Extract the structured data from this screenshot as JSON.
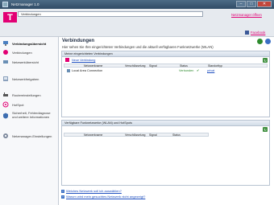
{
  "window": {
    "title": "Netzmanager 1.0",
    "minimize": "–",
    "maximize": "□",
    "close": "✕"
  },
  "header": {
    "address_value": "Verbindungen",
    "brand_mark": "T",
    "open_manager_link": "Netzmanager öffnen",
    "facebook_link": "Facebook"
  },
  "sidebar": {
    "items": [
      {
        "label": "Verbindungsübersicht",
        "icon": "network-overview-icon",
        "active": true
      },
      {
        "label": "Verbindungen",
        "icon": "connections-icon",
        "active": false
      },
      {
        "label": "Netzwerkübersicht",
        "icon": "network-map-icon",
        "active": false
      },
      {
        "label": "Netzwerkfreigaben",
        "icon": "share-icon",
        "active": false
      },
      {
        "label": "Routereinstellungen",
        "icon": "router-icon",
        "active": false
      },
      {
        "label": "HotSpot",
        "icon": "hotspot-icon",
        "active": false
      },
      {
        "label": "Sicherheit, Fehlerdiagnose und weitere Informationen",
        "icon": "security-icon",
        "active": false
      },
      {
        "label": "Netzmanager-Einstellungen",
        "icon": "settings-icon",
        "active": false
      }
    ]
  },
  "main": {
    "title": "Verbindungen",
    "subtitle": "Hier sehen Sie Ihre eingerichteten Verbindungen und die aktuell verfügbaren Funknetzwerke (WLAN)",
    "configured": {
      "header": "Meine eingerichteten Verbindungen",
      "new_connection": "Neue Verbindung",
      "columns": [
        "Netzwerkname",
        "Verschlüsselung",
        "Signal",
        "Status",
        "Standorttyp"
      ],
      "rows": [
        {
          "name": "Local Area Connection",
          "encryption": "",
          "signal": "",
          "status": "Verbunden",
          "location": "privat"
        }
      ]
    },
    "available": {
      "header": "Verfügbare Funknetzwerke (WLAN) und HotSpots",
      "columns": [
        "Netzwerkname",
        "Verschlüsselung",
        "Signal",
        "Status"
      ]
    },
    "help_links": [
      "Welches Netzwerk soll ich auswählen?",
      "Warum wird mein gesuchtes Netzwerk nicht angezeigt?"
    ]
  },
  "colors": {
    "brand": "#e20074",
    "link": "#1f4fbf",
    "refresh": "#3f8f3f",
    "status_ok": "#2e8b2e"
  }
}
